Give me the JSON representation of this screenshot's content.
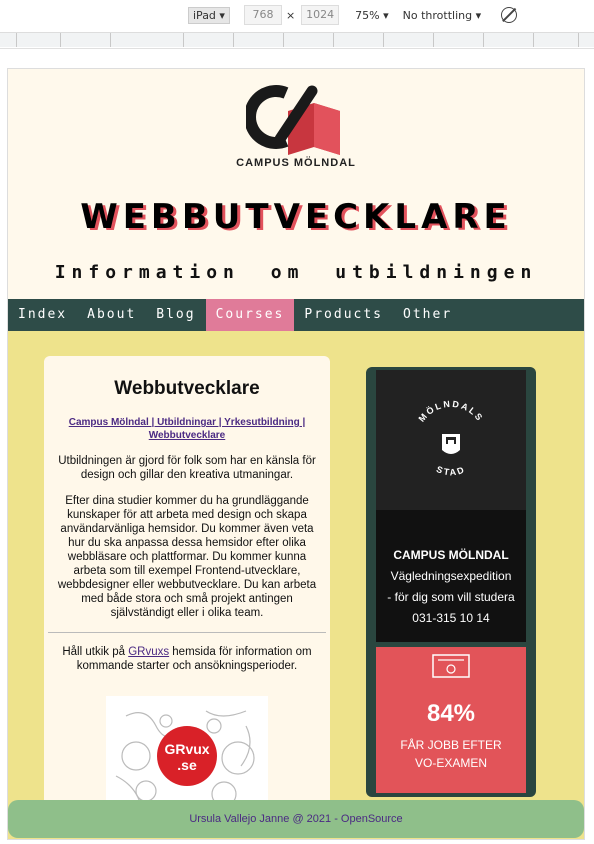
{
  "devtools": {
    "device": "iPad",
    "width": "768",
    "height": "1024",
    "times": "×",
    "zoom": "75%",
    "throttling": "No throttling"
  },
  "header": {
    "logo_text": "CAMPUS MÖLNDAL",
    "title": "WEBBUTVECKLARE",
    "subtitle": "Information om utbildningen"
  },
  "nav": {
    "items": [
      {
        "label": "Index"
      },
      {
        "label": "About"
      },
      {
        "label": "Blog"
      },
      {
        "label": "Courses"
      },
      {
        "label": "Products"
      },
      {
        "label": "Other"
      }
    ],
    "active": "Courses"
  },
  "main": {
    "heading": "Webbutvecklare",
    "breadcrumb": "Campus Mölndal | Utbildningar | Yrkesutbildning | Webbutvecklare",
    "p1": "Utbildningen är gjord för folk som har en känsla för design och gillar den kreativa utmaningar.",
    "p2": "Efter dina studier kommer du ha grundläggande kunskaper för att arbeta med design och skapa användarvänliga hemsidor. Du kommer även veta hur du ska anpassa dessa hemsidor efter olika webbläsare och plattformar. Du kommer kunna arbeta som till exempel Frontend-utvecklare, webbdesigner eller webbutvecklare. Du kan arbeta med både stora och små projekt antingen självständigt eller i olika team.",
    "p3_before": "Håll utkik på ",
    "p3_link": "GRvuxs",
    "p3_after": " hemsida för information om kommande starter och ansökningsperioder.",
    "grvux_logo_line1": "GRvux",
    "grvux_logo_line2": ".se"
  },
  "sidebar": {
    "stad_logo_top": "MÖLNDALS",
    "stad_logo_bottom": "STAD",
    "campus_title": "CAMPUS MÖLNDAL",
    "line2": "Vägledningsexpedition",
    "line3": "- för dig som vill studera",
    "phone": "031-315 10 14",
    "percent": "84%",
    "stat_line1": "FÅR JOBB EFTER",
    "stat_line2": "VO-EXAMEN"
  },
  "footer": {
    "text": "Ursula Vallejo Janne @ 2021 - OpenSource"
  },
  "colors": {
    "header_bg": "#fff9ec",
    "page_bg": "#eee38c",
    "nav_bg": "#2e4c48",
    "nav_active": "#e07b99",
    "title_shadow": "#e2525c",
    "footer_bg": "#8fbf8a",
    "link": "#4b2a83"
  }
}
